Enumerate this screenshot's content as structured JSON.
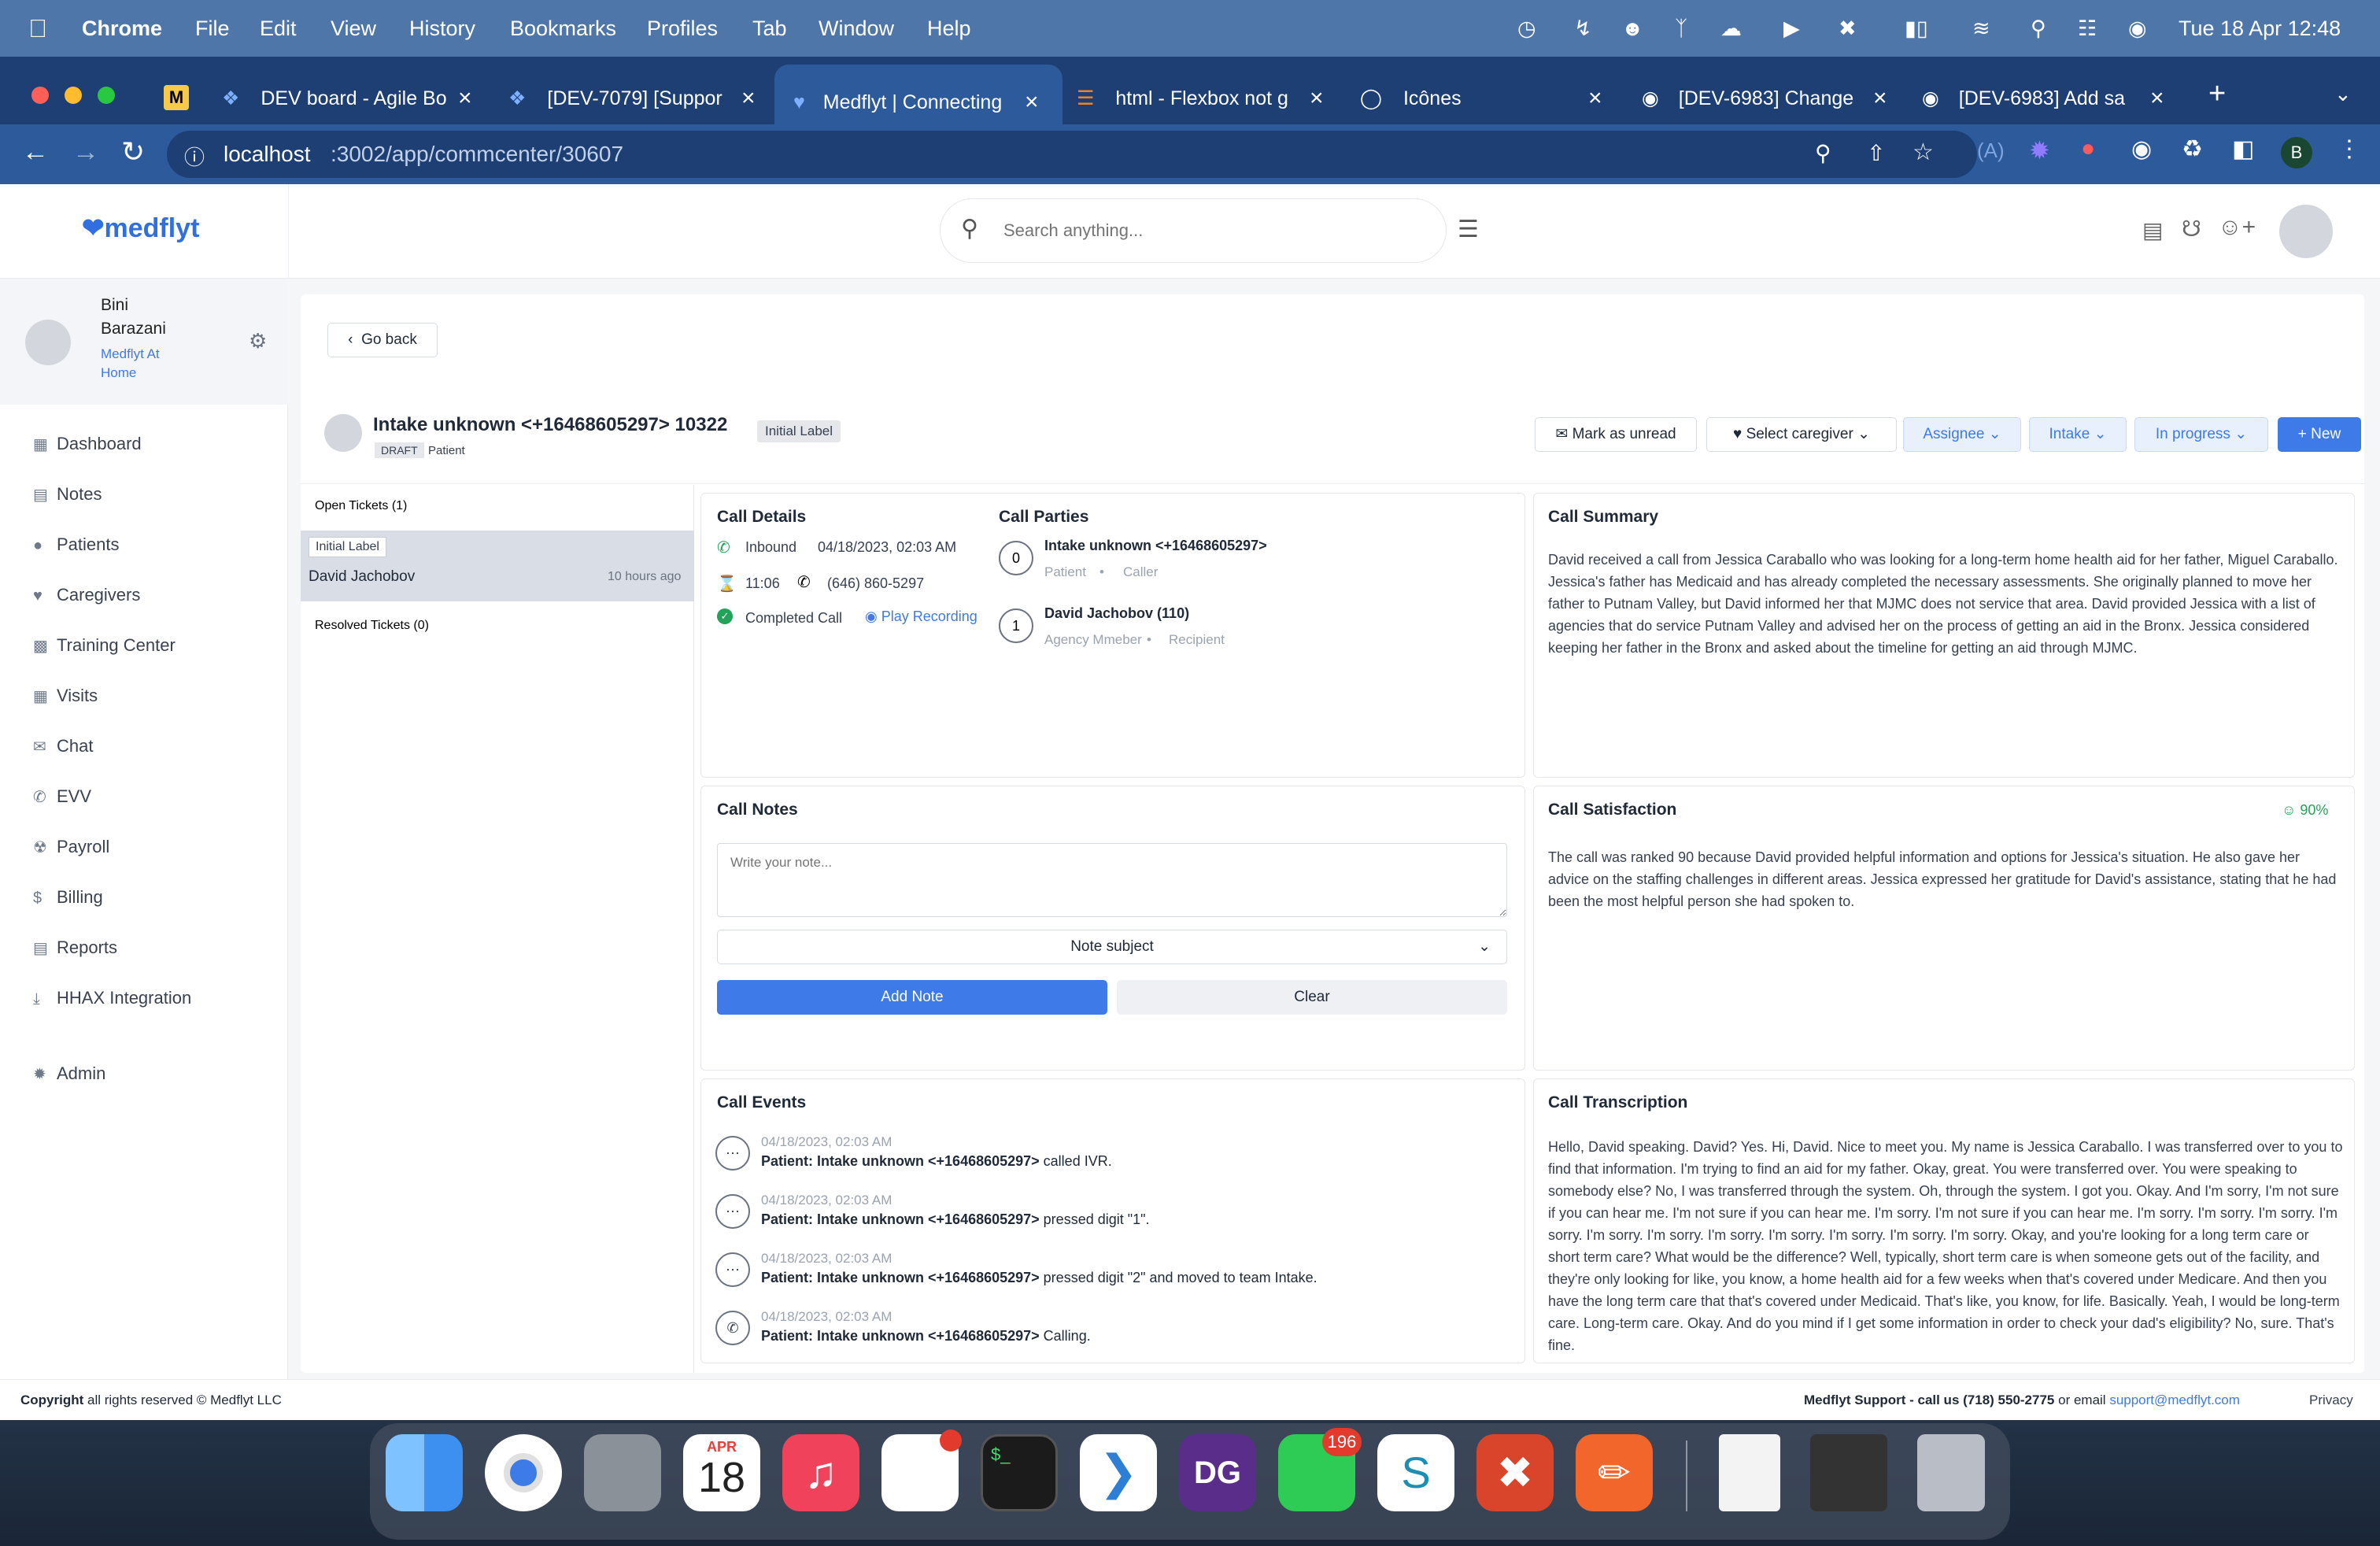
{
  "menubar": {
    "app": "Chrome",
    "items": [
      "File",
      "Edit",
      "View",
      "History",
      "Bookmarks",
      "Profiles",
      "Tab",
      "Window",
      "Help"
    ],
    "datetime": "Tue 18 Apr  12:48"
  },
  "tabs": [
    {
      "label": "DEV board - Agile Bo",
      "icon": "jira-icon"
    },
    {
      "label": "[DEV-7079] [Suppor",
      "icon": "jira-icon"
    },
    {
      "label": "Medflyt | Connecting",
      "icon": "medflyt-icon",
      "active": true
    },
    {
      "label": "html - Flexbox not g",
      "icon": "stackoverflow-icon"
    },
    {
      "label": "Icônes",
      "icon": "drop-icon"
    },
    {
      "label": "[DEV-6983] Change",
      "icon": "github-icon"
    },
    {
      "label": "[DEV-6983] Add sa",
      "icon": "github-icon"
    }
  ],
  "address": {
    "host": "localhost",
    "rest": ":3002/app/commcenter/30607",
    "profile": "B"
  },
  "header": {
    "logo": "medflyt",
    "search_placeholder": "Search anything..."
  },
  "user": {
    "first": "Bini",
    "last": "Barazani",
    "agency1": "Medflyt At",
    "agency2": "Home"
  },
  "sidebar": [
    {
      "label": "Dashboard",
      "icon": "dashboard-icon"
    },
    {
      "label": "Notes",
      "icon": "notes-icon"
    },
    {
      "label": "Patients",
      "icon": "patients-icon"
    },
    {
      "label": "Caregivers",
      "icon": "heart-icon"
    },
    {
      "label": "Training Center",
      "icon": "training-icon"
    },
    {
      "label": "Visits",
      "icon": "visits-icon"
    },
    {
      "label": "Chat",
      "icon": "chat-icon"
    },
    {
      "label": "EVV",
      "icon": "phone-icon"
    },
    {
      "label": "Payroll",
      "icon": "payroll-icon"
    },
    {
      "label": "Billing",
      "icon": "dollar-icon"
    },
    {
      "label": "Reports",
      "icon": "reports-icon"
    },
    {
      "label": "HHAX Integration",
      "icon": "download-icon"
    },
    {
      "label": "Admin",
      "icon": "gear-icon"
    }
  ],
  "page": {
    "back": "Go back",
    "title": "Intake unknown <+16468605297> 10322",
    "status": "DRAFT",
    "type": "Patient",
    "label": "Initial Label",
    "actions": {
      "mark": "Mark as unread",
      "caregiver": "Select caregiver",
      "assignee": "Assignee",
      "team": "Intake",
      "progress": "In progress",
      "new": "New"
    }
  },
  "tickets": {
    "open_title": "Open Tickets (1)",
    "ticket_label": "Initial Label",
    "ticket_name": "David Jachobov",
    "ticket_time": "10 hours ago",
    "resolved_title": "Resolved Tickets (0)"
  },
  "details": {
    "title": "Call Details",
    "direction": "Inbound",
    "datetime": "04/18/2023, 02:03 AM",
    "duration": "11:06",
    "phone": "(646) 860-5297",
    "status": "Completed Call",
    "recording": "Play Recording"
  },
  "parties": {
    "title": "Call Parties",
    "list": [
      {
        "idx": "0",
        "name": "Intake unknown <+16468605297>",
        "role": "Patient",
        "kind": "Caller"
      },
      {
        "idx": "1",
        "name": "David Jachobov (110)",
        "role": "Agency Mmeber",
        "kind": "Recipient"
      }
    ]
  },
  "summary": {
    "title": "Call Summary",
    "text": "David received a call from Jessica Caraballo who was looking for a long-term home health aid for her father, Miguel Caraballo. Jessica's father has Medicaid and has already completed the necessary assessments. She originally planned to move her father to Putnam Valley, but David informed her that MJMC does not service that area. David provided Jessica with a list of agencies that do service Putnam Valley and advised her on the process of getting an aid in the Bronx. Jessica considered keeping her father in the Bronx and asked about the timeline for getting an aid through MJMC."
  },
  "notes": {
    "title": "Call Notes",
    "placeholder": "Write your note...",
    "subject": "Note subject",
    "add": "Add Note",
    "clear": "Clear"
  },
  "satisfaction": {
    "title": "Call Satisfaction",
    "score": "90%",
    "text": "The call was ranked 90 because David provided helpful information and options for Jessica's situation. He also gave her advice on the staffing challenges in different areas. Jessica expressed her gratitude for David's assistance, stating that he had been the most helpful person she had spoken to."
  },
  "events": {
    "title": "Call Events",
    "list": [
      {
        "time": "04/18/2023, 02:03 AM",
        "who": "Patient: Intake unknown <+16468605297>",
        "what": " called IVR."
      },
      {
        "time": "04/18/2023, 02:03 AM",
        "who": "Patient: Intake unknown <+16468605297>",
        "what": " pressed digit \"1\"."
      },
      {
        "time": "04/18/2023, 02:03 AM",
        "who": "Patient: Intake unknown <+16468605297>",
        "what": " pressed digit \"2\" and moved to team Intake."
      },
      {
        "time": "04/18/2023, 02:03 AM",
        "who": "Patient: Intake unknown <+16468605297>",
        "what": " Calling."
      }
    ]
  },
  "transcription": {
    "title": "Call Transcription",
    "text": "Hello, David speaking. David? Yes. Hi, David. Nice to meet you. My name is Jessica Caraballo. I was transferred over to you to find that information. I'm trying to find an aid for my father. Okay, great. You were transferred over. You were speaking to somebody else? No, I was transferred through the system. Oh, through the system. I got you. Okay. And I'm sorry, I'm not sure if you can hear me. I'm not sure if you can hear me. I'm sorry. I'm not sure if you can hear me. I'm sorry. I'm sorry. I'm sorry. I'm sorry. I'm sorry. I'm sorry. I'm sorry. I'm sorry. I'm sorry. I'm sorry. I'm sorry. Okay, and you're looking for a long term care or short term care? What would be the difference? Well, typically, short term care is when someone gets out of the facility, and they're only looking for like, you know, a home health aid for a few weeks when that's covered under Medicare. And then you have the long term care that that's covered under Medicaid. That's like, you know, for life. Basically. Yeah, I would be long-term care. Long-term care. Okay. And do you mind if I get some information in order to check your dad's eligibility? No, sure. That's fine."
  },
  "footer": {
    "copyright_bold": "Copyright",
    "copyright_rest": " all rights reserved © Medflyt LLC",
    "support": "Medflyt Support - call us (718) 550-2775",
    "or_email": " or email ",
    "email": "support@medflyt.com",
    "privacy": "Privacy"
  },
  "dock": {
    "calendar_month": "APR",
    "calendar_day": "18",
    "messages_badge": "196",
    "items": [
      "finder",
      "chrome",
      "launchpad",
      "calendar",
      "music",
      "slack",
      "terminal",
      "vscode",
      "datagrip",
      "messages",
      "surfshark",
      "remote-desktop",
      "postman",
      "document",
      "screenshot",
      "trash"
    ]
  },
  "colors": {
    "brand": "#3e7be8",
    "menubar": "#4f76a9",
    "tabstrip": "#1d3f74",
    "success": "#22a35a"
  }
}
